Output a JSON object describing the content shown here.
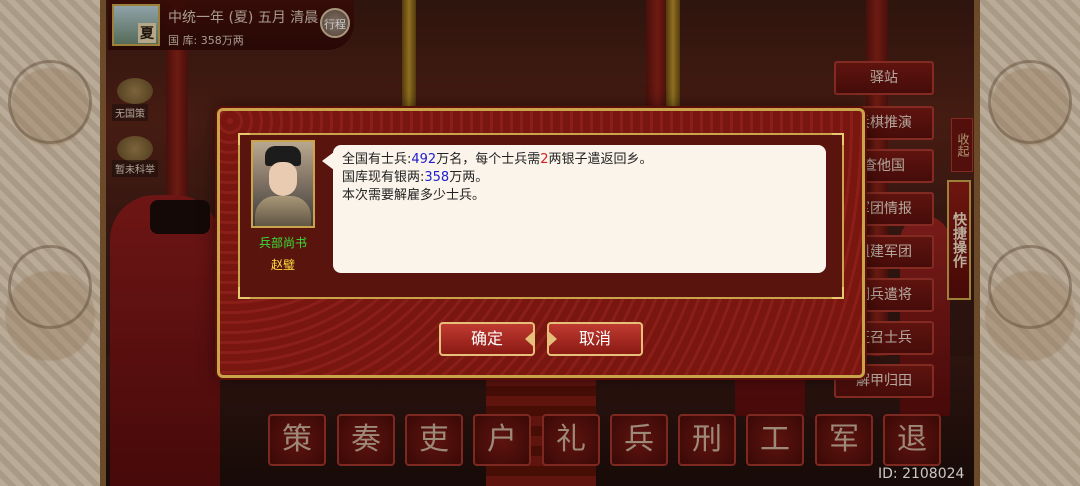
{
  "top_bar": {
    "season_char": "夏",
    "date": "中统一年 (夏) 五月 清晨",
    "treasury": "国 库: 358万两",
    "journey_label": "行程"
  },
  "left_icons": [
    {
      "label": "无国策"
    },
    {
      "label": "暂未科举"
    }
  ],
  "right_menu": [
    "驿站",
    "兵棋推演",
    "查他国",
    "军团情报",
    "组建军团",
    "调兵遣将",
    "征召士兵",
    "解甲归田"
  ],
  "quick_tab": "快捷操作",
  "side_tab": "收起",
  "dialog": {
    "speaker_title": "兵部尚书",
    "speaker_name": "赵璧",
    "line1_pre": "全国有士兵:",
    "soldiers": "492",
    "line1_mid": "万名，每个士兵需",
    "cost": "2",
    "line1_post": "两银子遣返回乡。",
    "line2_pre": "国库现有银两:",
    "silver": "358",
    "line2_post": "万两。",
    "line3": "本次需要解雇多少士兵。",
    "confirm": "确定",
    "cancel": "取消"
  },
  "departments": [
    "策",
    "奏",
    "吏",
    "户",
    "礼",
    "兵",
    "刑",
    "工",
    "军",
    "退"
  ],
  "id_text": "ID: 2108024",
  "colors": {
    "gold_border": "#c9a44a",
    "dialog_red": "#7c1812",
    "speaker_title_green": "#38e038",
    "speaker_name_yellow": "#ffe040",
    "number_blue": "#2020d0",
    "number_red": "#d02020"
  }
}
